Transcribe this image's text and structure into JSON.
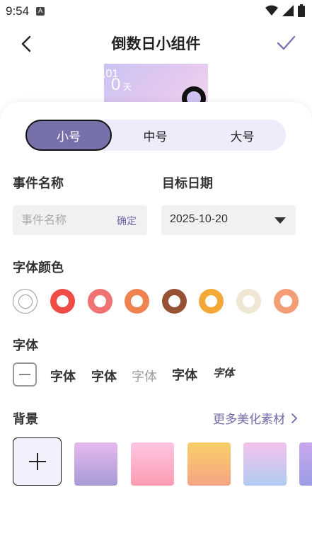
{
  "status": {
    "time": "9:54",
    "notification_badge": "A"
  },
  "topbar": {
    "title": "倒数日小组件"
  },
  "preview": {
    "date": ".01",
    "number": "0",
    "unit": "天"
  },
  "size_tabs": [
    {
      "label": "小号",
      "active": true
    },
    {
      "label": "中号",
      "active": false
    },
    {
      "label": "大号",
      "active": false
    }
  ],
  "event": {
    "name_label": "事件名称",
    "name_placeholder": "事件名称",
    "name_confirm": "确定",
    "date_label": "目标日期",
    "date_value": "2025-10-20"
  },
  "font_color": {
    "label": "字体颜色",
    "colors": [
      "#ffffff",
      "#ef4b47",
      "#f07272",
      "#ef8350",
      "#975233",
      "#f3a838",
      "#efe6d3",
      "#f49e76"
    ]
  },
  "font": {
    "label": "字体",
    "options": [
      "字体",
      "字体",
      "字体",
      "字体",
      "字体"
    ]
  },
  "background": {
    "label": "背景",
    "more_link": "更多美化素材",
    "tiles": [
      "linear-gradient(180deg,#e6b9ee,#a99ad6)",
      "linear-gradient(180deg,#ffc7e2,#fb9cb2)",
      "linear-gradient(180deg,#f7d06a,#f7a484)",
      "linear-gradient(180deg,#f4c3ec,#b1cbf2)",
      "linear-gradient(180deg,#c9a8ee,#9c9de6)"
    ]
  }
}
